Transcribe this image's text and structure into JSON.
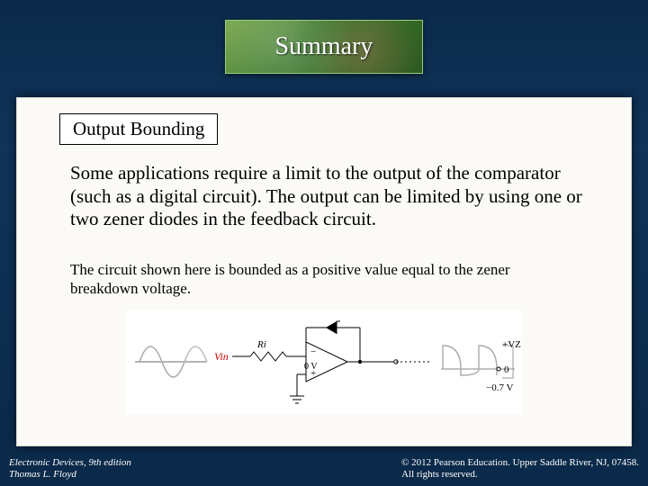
{
  "title": "Summary",
  "subtitle": "Output Bounding",
  "paragraph1": "Some applications require a limit to the output of the comparator (such as a digital circuit). The output can be limited by using one or two zener diodes in the feedback circuit.",
  "paragraph2": "The circuit shown here is bounded as a positive value equal to the zener breakdown voltage.",
  "diagram": {
    "labels": {
      "vin": "Vin",
      "ri": "Ri",
      "zero_v": "0 V",
      "plus_vz": "+VZ",
      "zero": "0",
      "neg07": "−0.7 V",
      "minus": "−",
      "plus": "+"
    }
  },
  "footer": {
    "left_line1": "Electronic Devices, 9th edition",
    "left_line2": "Thomas L. Floyd",
    "right_line1": "© 2012 Pearson Education. Upper Saddle River, NJ, 07458.",
    "right_line2": "All rights reserved."
  }
}
